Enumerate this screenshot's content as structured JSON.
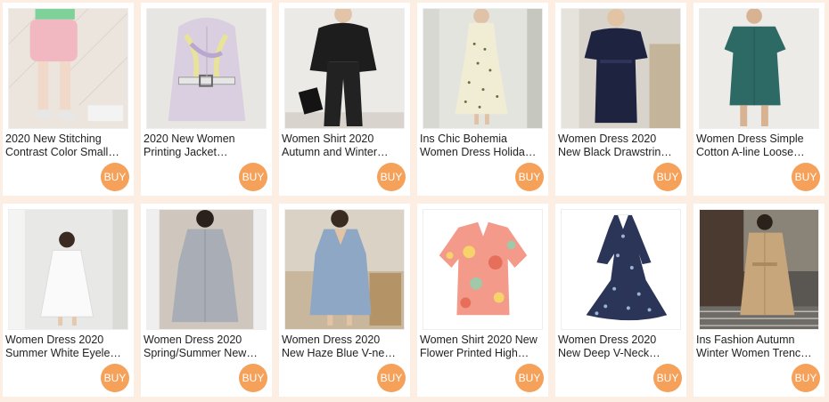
{
  "products": [
    {
      "line1": "2020 New Stitching",
      "line2": "Contrast Color Small…",
      "buy": "BUY",
      "icon": "pink-shorts-photo",
      "bg": "#e9e3dd",
      "fg": "#f1b8c2"
    },
    {
      "line1": "2020 New Women",
      "line2": "Printing Jacket…",
      "buy": "BUY",
      "icon": "printed-jacket-photo",
      "bg": "#e8e6e3",
      "fg": "#d9cfe0"
    },
    {
      "line1": "Women Shirt 2020",
      "line2": "Autumn and Winter…",
      "buy": "BUY",
      "icon": "black-outfit-photo",
      "bg": "#eceae6",
      "fg": "#1d1d1d"
    },
    {
      "line1": "Ins Chic Bohemia",
      "line2": "Women Dress Holida…",
      "buy": "BUY",
      "icon": "cream-dress-photo",
      "bg": "#e4e4de",
      "fg": "#f1ecd4"
    },
    {
      "line1": "Women Dress 2020",
      "line2": "New Black Drawstrin…",
      "buy": "BUY",
      "icon": "navy-dress-photo",
      "bg": "#d9d4cb",
      "fg": "#1e2340"
    },
    {
      "line1": "Women Dress Simple",
      "line2": "Cotton A-line Loose…",
      "buy": "BUY",
      "icon": "teal-dress-photo",
      "bg": "#ecebe8",
      "fg": "#2d6a66"
    },
    {
      "line1": "Women Dress 2020",
      "line2": "Summer White Eyele…",
      "buy": "BUY",
      "icon": "white-dress-photo",
      "bg": "#e8e8e6",
      "fg": "#fafafa"
    },
    {
      "line1": "Women Dress 2020",
      "line2": "Spring/Summer New…",
      "buy": "BUY",
      "icon": "grey-shirt-dress-photo",
      "bg": "#cfc7bd",
      "fg": "#a9adb6"
    },
    {
      "line1": "Women Dress 2020",
      "line2": "New Haze Blue V-ne…",
      "buy": "BUY",
      "icon": "blue-dress-photo",
      "bg": "#c9b79d",
      "fg": "#8ea7c4"
    },
    {
      "line1": "Women Shirt 2020 New",
      "line2": "Flower Printed High…",
      "buy": "BUY",
      "icon": "floral-shirt-photo",
      "bg": "#ffffff",
      "fg": "#f39a8a"
    },
    {
      "line1": "Women Dress 2020",
      "line2": "New Deep V-Neck…",
      "buy": "BUY",
      "icon": "floral-navy-dress-photo",
      "bg": "#ffffff",
      "fg": "#2a3558"
    },
    {
      "line1": "Ins Fashion Autumn",
      "line2": "Winter Women Trenc…",
      "buy": "BUY",
      "icon": "trench-coat-photo",
      "bg": "#5a5651",
      "fg": "#c8a67c"
    }
  ]
}
